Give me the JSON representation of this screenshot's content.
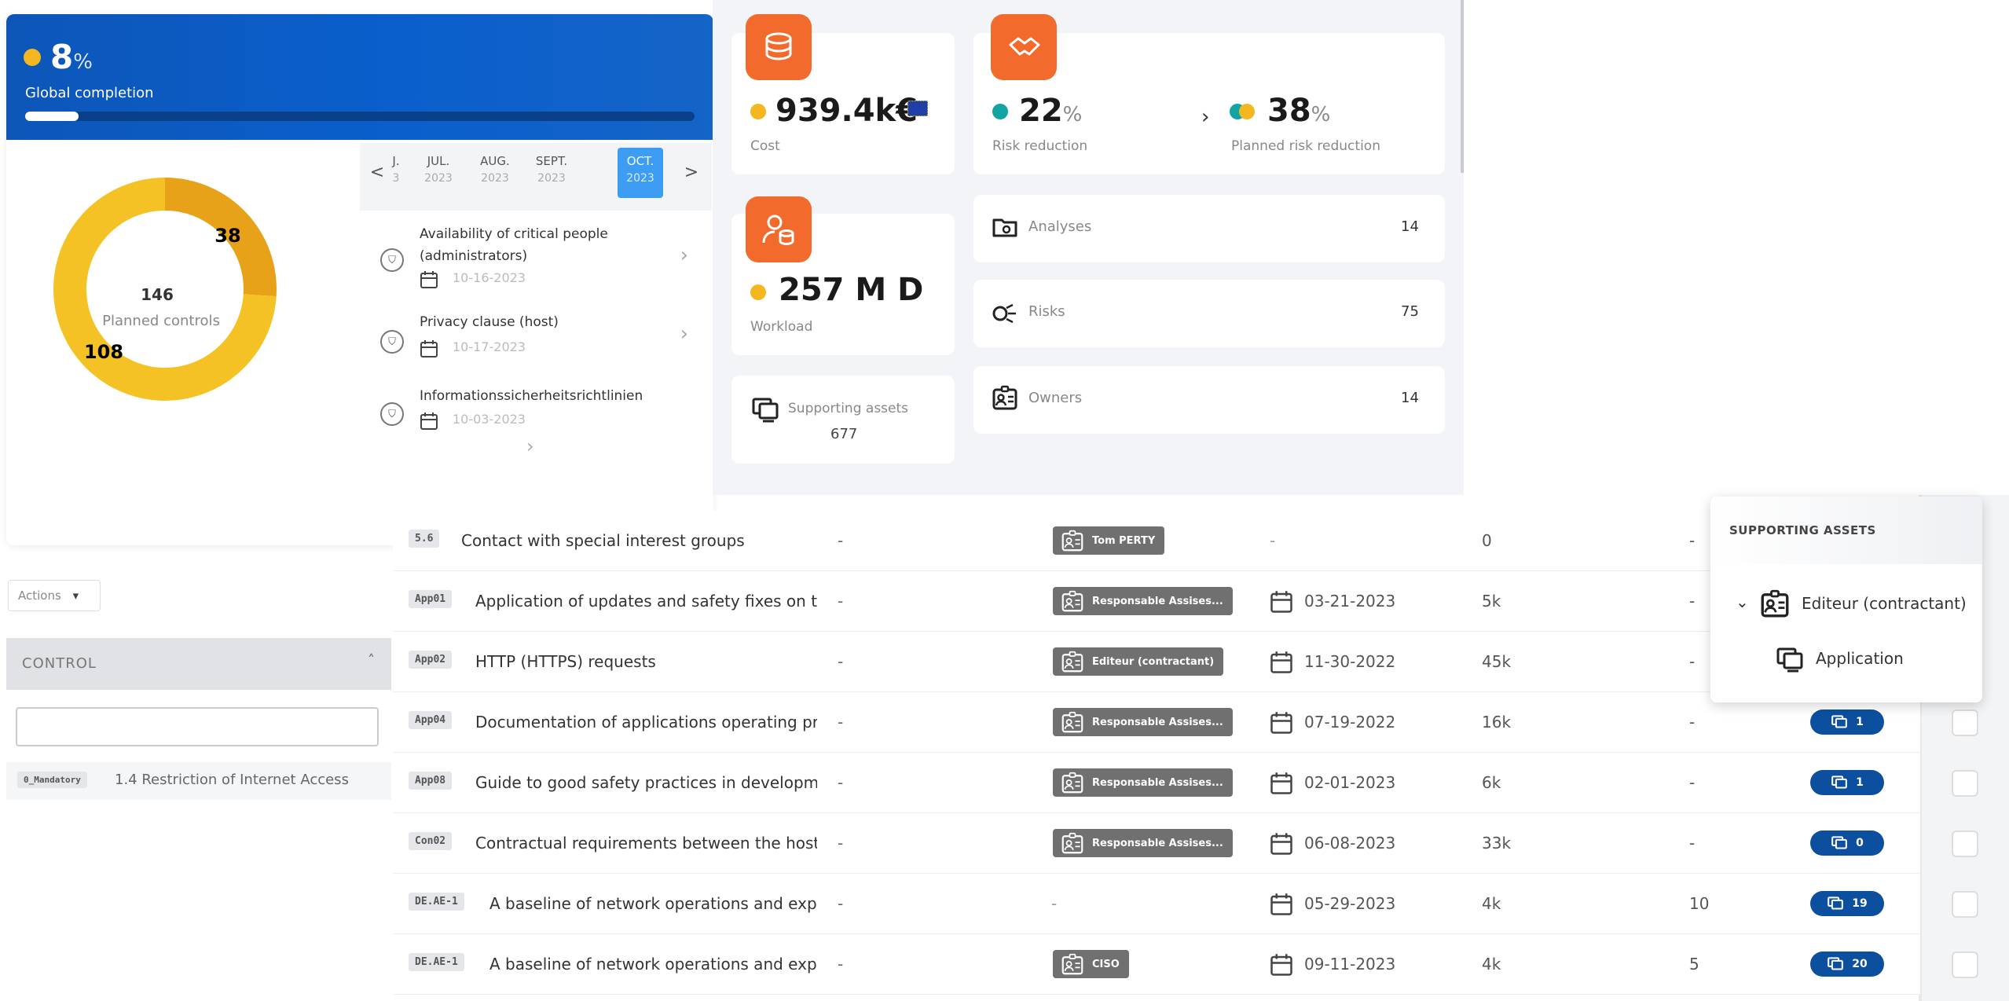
{
  "global": {
    "percent": "8",
    "percent_symbol": "%",
    "label": "Global completion",
    "progress_fraction": 0.08
  },
  "donut": {
    "total": "146",
    "caption": "Planned controls",
    "segments": [
      {
        "label": "38",
        "value": 38,
        "color": "#e8a21a"
      },
      {
        "label": "108",
        "value": 108,
        "color": "#f5c226"
      }
    ]
  },
  "calendar": {
    "prev": "<",
    "next": ">",
    "months": [
      {
        "m": "J.",
        "y": "3"
      },
      {
        "m": "JUL.",
        "y": "2023"
      },
      {
        "m": "AUG.",
        "y": "2023"
      },
      {
        "m": "SEPT.",
        "y": "2023"
      },
      {
        "m": "OCT.",
        "y": "2023",
        "active": true
      }
    ]
  },
  "upcoming": [
    {
      "title": "Availability of critical people (administrators)",
      "date": "10-16-2023"
    },
    {
      "title": "Privacy clause (host)",
      "date": "10-17-2023"
    },
    {
      "title": "Informationssicherheitsrichtlinien",
      "date": "10-03-2023"
    }
  ],
  "metrics": {
    "cost": {
      "value": "939.4k€",
      "label": "Cost"
    },
    "risk": {
      "value": "22",
      "unit": "%",
      "label": "Risk reduction",
      "planned_value": "38",
      "planned_label": "Planned risk reduction"
    },
    "workload": {
      "value": "257 M D",
      "label": "Workload"
    },
    "supporting": {
      "label": "Supporting assets",
      "value": "677"
    },
    "list": [
      {
        "label": "Analyses",
        "value": "14"
      },
      {
        "label": "Risks",
        "value": "75"
      },
      {
        "label": "Owners",
        "value": "14"
      }
    ]
  },
  "filters": {
    "actions_label": "Actions",
    "control_header": "CONTROL",
    "mandatory_tag": "0_Mandatory",
    "mandatory_text": "1.4 Restriction of Internet Access"
  },
  "rows": [
    {
      "code": "5.6",
      "title": "Contact with special interest groups",
      "dash": "-",
      "owner": "Tom PERTY",
      "date": "-",
      "workload": "0",
      "count": "-",
      "assets": null
    },
    {
      "code": "App01",
      "title": "Application of updates and safety fixes on th",
      "dash": "-",
      "owner": "Responsable Assises...",
      "date": "03-21-2023",
      "workload": "5k",
      "count": "-",
      "assets": null
    },
    {
      "code": "App02",
      "title": "HTTP (HTTPS) requests",
      "dash": "-",
      "owner": "Editeur (contractant)",
      "date": "11-30-2022",
      "workload": "45k",
      "count": "-",
      "assets": null
    },
    {
      "code": "App04",
      "title": "Documentation of applications operating prc",
      "dash": "-",
      "owner": "Responsable Assises...",
      "date": "07-19-2022",
      "workload": "16k",
      "count": "-",
      "assets": "1"
    },
    {
      "code": "App08",
      "title": "Guide to good safety practices in developme",
      "dash": "-",
      "owner": "Responsable Assises...",
      "date": "02-01-2023",
      "workload": "6k",
      "count": "-",
      "assets": "1"
    },
    {
      "code": "Con02",
      "title": "Contractual requirements between the host",
      "dash": "-",
      "owner": "Responsable Assises...",
      "date": "06-08-2023",
      "workload": "33k",
      "count": "-",
      "assets": "0"
    },
    {
      "code": "DE.AE-1",
      "title": "A baseline of network operations and expe",
      "dash": "-",
      "owner": "-",
      "date": "05-29-2023",
      "workload": "4k",
      "count": "10",
      "assets": "19"
    },
    {
      "code": "DE.AE-1",
      "title": "A baseline of network operations and expe",
      "dash": "-",
      "owner": "CISO",
      "date": "09-11-2023",
      "workload": "4k",
      "count": "5",
      "assets": "20"
    }
  ],
  "popup": {
    "title": "SUPPORTING ASSETS",
    "parent": "Editeur (contractant)",
    "child": "Application"
  }
}
